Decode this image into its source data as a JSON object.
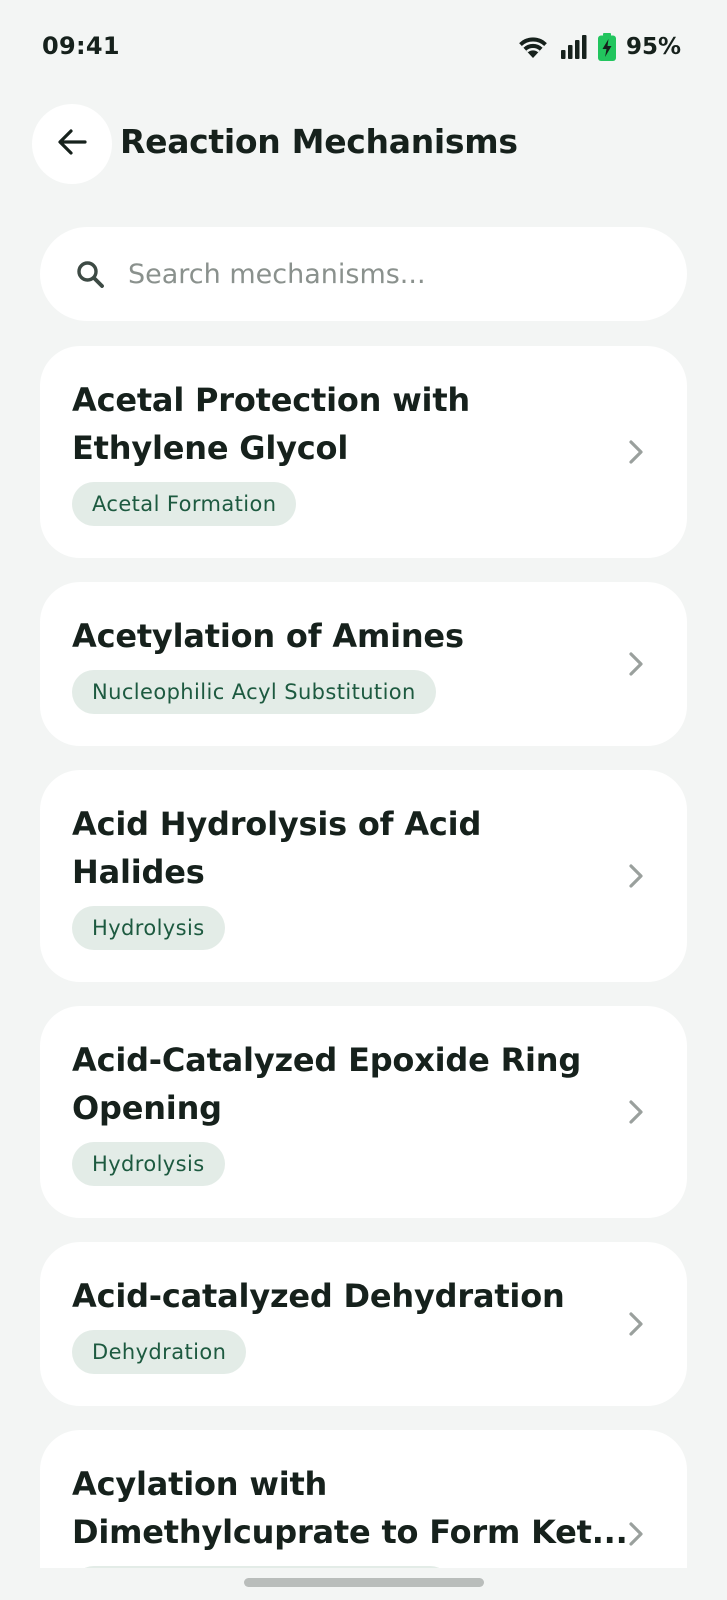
{
  "status_bar": {
    "time": "09:41",
    "battery_percent": "95%",
    "icons": [
      "wifi-icon",
      "signal-icon",
      "battery-charging-icon"
    ]
  },
  "header": {
    "title": "Reaction Mechanisms",
    "back_icon": "arrow-left-icon"
  },
  "search": {
    "placeholder": "Search mechanisms..."
  },
  "mechanisms": [
    {
      "line1": "Acetal Protection with",
      "line2": "Ethylene Glycol",
      "category": "Acetal Formation"
    },
    {
      "line1": "Acetylation of Amines",
      "line2": "",
      "category": "Nucleophilic Acyl Substitution"
    },
    {
      "line1": "Acid Hydrolysis of Acid",
      "line2": "Halides",
      "category": "Hydrolysis"
    },
    {
      "line1": "Acid-Catalyzed Epoxide Ring",
      "line2": "Opening",
      "category": "Hydrolysis"
    },
    {
      "line1": "Acid-catalyzed Dehydration",
      "line2": "",
      "category": "Dehydration"
    },
    {
      "line1": "Acylation with",
      "line2": "Dimethylcuprate to Form Ket...",
      "category": ""
    }
  ],
  "colors": {
    "background": "#f3f5f4",
    "card": "#ffffff",
    "tag_bg": "#e3ece7",
    "tag_text": "#1d5a40",
    "battery": "#22c55e"
  }
}
